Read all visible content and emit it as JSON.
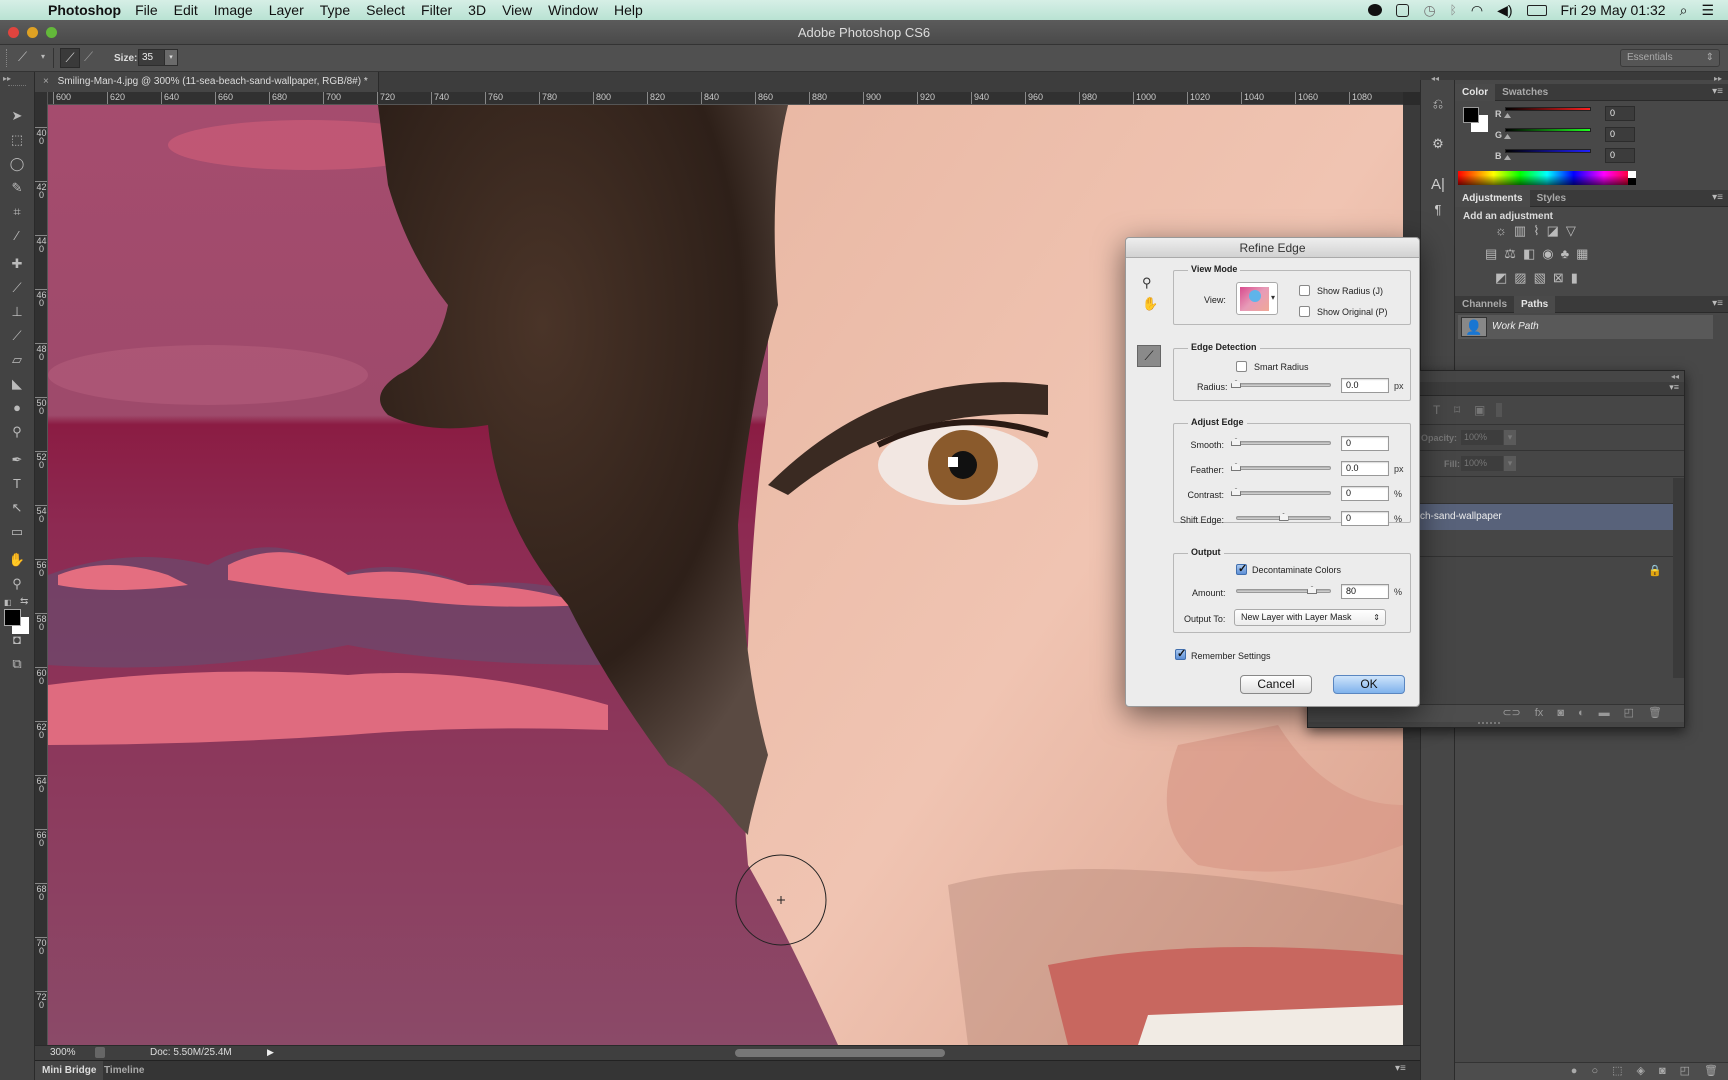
{
  "menubar": {
    "app": "Photoshop",
    "items": [
      "File",
      "Edit",
      "Image",
      "Layer",
      "Type",
      "Select",
      "Filter",
      "3D",
      "View",
      "Window",
      "Help"
    ],
    "status_icons": [
      "line-icon",
      "checkbox-icon",
      "time-machine-icon",
      "bluetooth-icon",
      "wifi-icon",
      "volume-icon",
      "battery-icon"
    ],
    "clock": "Fri 29 May  01:32"
  },
  "window": {
    "title": "Adobe Photoshop CS6"
  },
  "options_bar": {
    "size_label": "Size:",
    "size_value": "35",
    "workspace": "Essentials"
  },
  "document": {
    "tab_title": "Smiling-Man-4.jpg @ 300% (11-sea-beach-sand-wallpaper, RGB/8#) *",
    "ruler_top": [
      "600",
      "620",
      "640",
      "660",
      "680",
      "700",
      "720",
      "740",
      "760",
      "780",
      "800",
      "820",
      "840",
      "860",
      "880",
      "900",
      "920",
      "940",
      "960",
      "980",
      "1000",
      "1020",
      "1040",
      "1060",
      "1080"
    ],
    "ruler_left": [
      "400",
      "420",
      "440",
      "460",
      "480",
      "500",
      "520",
      "540",
      "560",
      "580",
      "600",
      "620",
      "640",
      "660",
      "680",
      "700",
      "720"
    ]
  },
  "status_bar": {
    "zoom": "300%",
    "doc_info": "Doc: 5.50M/25.4M"
  },
  "bottom_tabs": [
    "Mini Bridge",
    "Timeline"
  ],
  "refine_edge": {
    "title": "Refine Edge",
    "view_mode": {
      "heading": "View Mode",
      "view_label": "View:",
      "show_radius": {
        "label": "Show Radius (J)",
        "checked": false
      },
      "show_original": {
        "label": "Show Original (P)",
        "checked": false
      }
    },
    "edge_detection": {
      "heading": "Edge Detection",
      "smart_radius": {
        "label": "Smart Radius",
        "checked": false
      },
      "radius": {
        "label": "Radius:",
        "value": "0.0",
        "unit": "px",
        "fraction": 0.0
      }
    },
    "adjust_edge": {
      "heading": "Adjust Edge",
      "smooth": {
        "label": "Smooth:",
        "value": "0",
        "unit": "",
        "fraction": 0.0
      },
      "feather": {
        "label": "Feather:",
        "value": "0.0",
        "unit": "px",
        "fraction": 0.0
      },
      "contrast": {
        "label": "Contrast:",
        "value": "0",
        "unit": "%",
        "fraction": 0.0
      },
      "shift_edge": {
        "label": "Shift Edge:",
        "value": "0",
        "unit": "%",
        "fraction": 0.5
      }
    },
    "output": {
      "heading": "Output",
      "decontaminate": {
        "label": "Decontaminate Colors",
        "checked": true
      },
      "amount": {
        "label": "Amount:",
        "value": "80",
        "unit": "%",
        "fraction": 0.8
      },
      "output_to_label": "Output To:",
      "output_to_value": "New Layer with Layer Mask"
    },
    "remember": {
      "label": "Remember Settings",
      "checked": true
    },
    "cancel_label": "Cancel",
    "ok_label": "OK"
  },
  "color_panel": {
    "tabs": [
      "Color",
      "Swatches"
    ],
    "channels": [
      {
        "name": "R",
        "value": "0",
        "color": "#ff2020"
      },
      {
        "name": "G",
        "value": "0",
        "color": "#20ff20"
      },
      {
        "name": "B",
        "value": "0",
        "color": "#2020ff"
      }
    ]
  },
  "adjustments_panel": {
    "tabs": [
      "Adjustments",
      "Styles"
    ],
    "heading": "Add an adjustment"
  },
  "paths_panel": {
    "tabs": [
      "Channels",
      "Paths"
    ],
    "items": [
      "Work Path"
    ]
  },
  "layers_panel": {
    "opacity_label": "Opacity:",
    "opacity_value": "100%",
    "fill_label": "Fill:",
    "fill_value": "100%",
    "layer_name": "ch-sand-wallpaper"
  },
  "colors": {
    "foreground": "#000000",
    "background": "#ffffff",
    "overlay": "#9a4a6a"
  }
}
